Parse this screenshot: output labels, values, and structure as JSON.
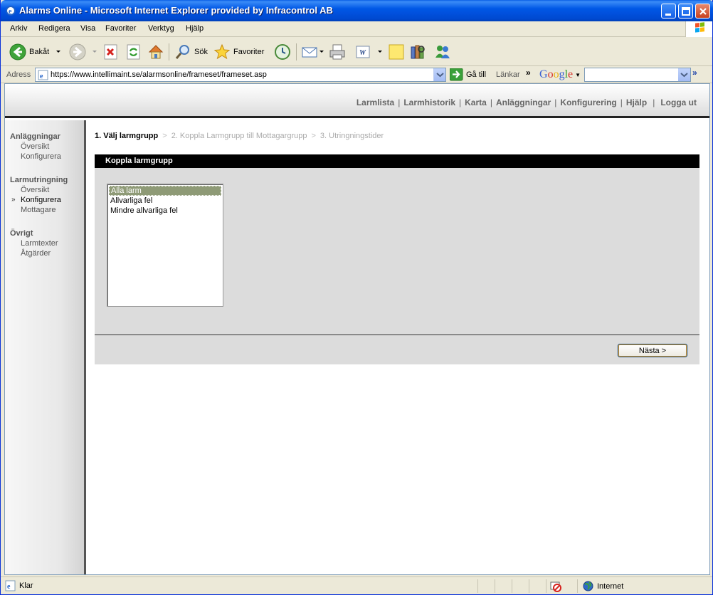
{
  "window": {
    "title": "Alarms Online - Microsoft Internet Explorer provided by Infracontrol AB",
    "app_icon": "ie-icon"
  },
  "menubar": {
    "items": [
      "Arkiv",
      "Redigera",
      "Visa",
      "Favoriter",
      "Verktyg",
      "Hjälp"
    ]
  },
  "toolbar": {
    "back_label": "Bakåt",
    "search_label": "Sök",
    "favorites_label": "Favoriter"
  },
  "addressbar": {
    "label": "Adress",
    "url": "https://www.intellimaint.se/alarmsonline/frameset/frameset.asp",
    "go_label": "Gå till",
    "links_label": "Länkar",
    "google_label": "Google",
    "google_search_value": ""
  },
  "topnav": {
    "items": [
      "Larmlista",
      "Larmhistorik",
      "Karta",
      "Anläggningar",
      "Konfigurering",
      "Hjälp",
      "Logga ut"
    ]
  },
  "sidebar": {
    "sections": [
      {
        "heading": "Anläggningar",
        "links": [
          "Översikt",
          "Konfigurera"
        ]
      },
      {
        "heading": "Larmutringning",
        "links": [
          "Översikt",
          "Konfigurera",
          "Mottagare"
        ]
      },
      {
        "heading": "Övrigt",
        "links": [
          "Larmtexter",
          "Åtgärder"
        ]
      }
    ],
    "active_marker": "»"
  },
  "wizard": {
    "steps": [
      "1. Välj larmgrupp",
      "2. Koppla Larmgrupp till Mottagargrupp",
      "3. Utringningstider"
    ],
    "separator": ">"
  },
  "panel": {
    "title": "Koppla larmgrupp",
    "options": [
      "Alla larm",
      "Allvarliga fel",
      "Mindre allvarliga fel"
    ],
    "selected_index": 0,
    "next_label": "Nästa >"
  },
  "statusbar": {
    "status": "Klar",
    "zone": "Internet"
  },
  "colors": {
    "titlebar": "#0058E6",
    "selected_option": "#8E9A76",
    "panel_bg": "#DCDCDC"
  }
}
